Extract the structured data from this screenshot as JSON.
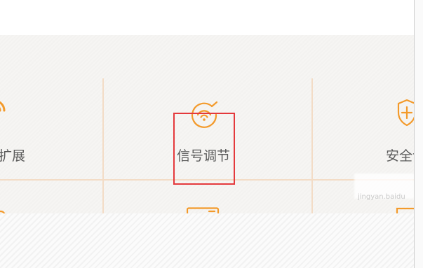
{
  "grid": {
    "items": [
      {
        "label": "扩展",
        "icon": "wifi-signal-icon"
      },
      {
        "label": "信号调节",
        "icon": "signal-adjust-icon"
      },
      {
        "label": "安全设",
        "icon": "shield-plus-icon"
      }
    ],
    "second_row_icons": [
      "device-icon",
      "router-icon",
      "panel-icon"
    ]
  },
  "watermark": {
    "text": "jingyan.baidu"
  },
  "colors": {
    "accent_orange": "#f39a2b",
    "highlight_red": "#e4393c",
    "divider": "#f3dcc6",
    "panel_bg": "#f6f5f3",
    "label_gray": "#5a5a5a"
  }
}
